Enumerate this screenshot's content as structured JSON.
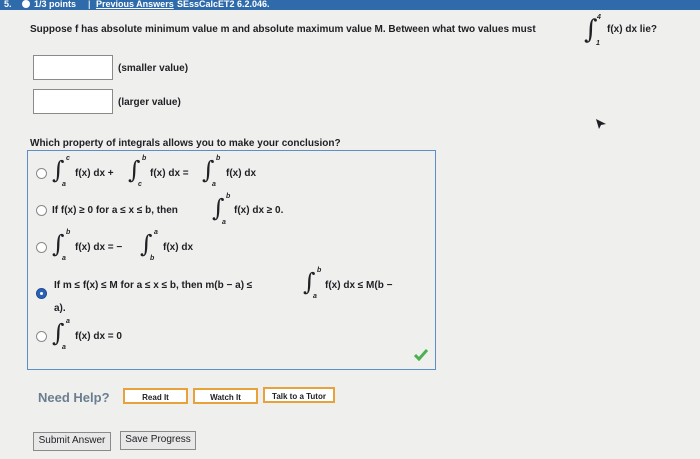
{
  "header": {
    "question_number": "5.",
    "points": "1/3 points",
    "separator": "|",
    "previous_answers": "Previous Answers",
    "source": "SEssCalcET2 6.2.046."
  },
  "question": {
    "text": "Suppose f has absolute minimum value m and absolute maximum value M. Between what two values must",
    "integral_upper": "4",
    "integral_lower": "1",
    "integral_tail": "f(x) dx  lie?"
  },
  "inputs": {
    "smaller_value": "",
    "smaller_label": "(smaller value)",
    "larger_value": "",
    "larger_label": "(larger value)"
  },
  "property_question": "Which property of integrals allows you to make your conclusion?",
  "options": [
    {
      "parts": [
        "f(x) dx +",
        "f(x) dx =",
        "f(x) dx"
      ],
      "bounds": [
        [
          "c",
          "a"
        ],
        [
          "b",
          "c"
        ],
        [
          "b",
          "a"
        ]
      ],
      "selected": false
    },
    {
      "prefix": "If f(x) ≥ 0 for a ≤ x ≤ b, then",
      "tail": "f(x) dx ≥ 0.",
      "bounds": [
        [
          "b",
          "a"
        ]
      ],
      "selected": false
    },
    {
      "parts": [
        "f(x) dx = −",
        "f(x) dx"
      ],
      "bounds": [
        [
          "b",
          "a"
        ],
        [
          "a",
          "b"
        ]
      ],
      "selected": false
    },
    {
      "prefix": "If m ≤ f(x) ≤ M for a ≤ x ≤ b, then m(b − a) ≤",
      "tail": "f(x) dx ≤ M(b −",
      "line2": "a).",
      "bounds": [
        [
          "b",
          "a"
        ]
      ],
      "selected": true
    },
    {
      "parts": [
        "f(x) dx = 0"
      ],
      "bounds": [
        [
          "a",
          "a"
        ]
      ],
      "selected": false
    }
  ],
  "help": {
    "need_help": "Need Help?",
    "read_it": "Read It",
    "watch_it": "Watch It",
    "talk_to_tutor": "Talk to a Tutor"
  },
  "actions": {
    "submit": "Submit Answer",
    "save": "Save Progress"
  },
  "colors": {
    "header_blue": "#2f6bab",
    "selected_radio": "#2b62b7",
    "check_green": "#4caf50",
    "help_border": "#e8a23b"
  }
}
